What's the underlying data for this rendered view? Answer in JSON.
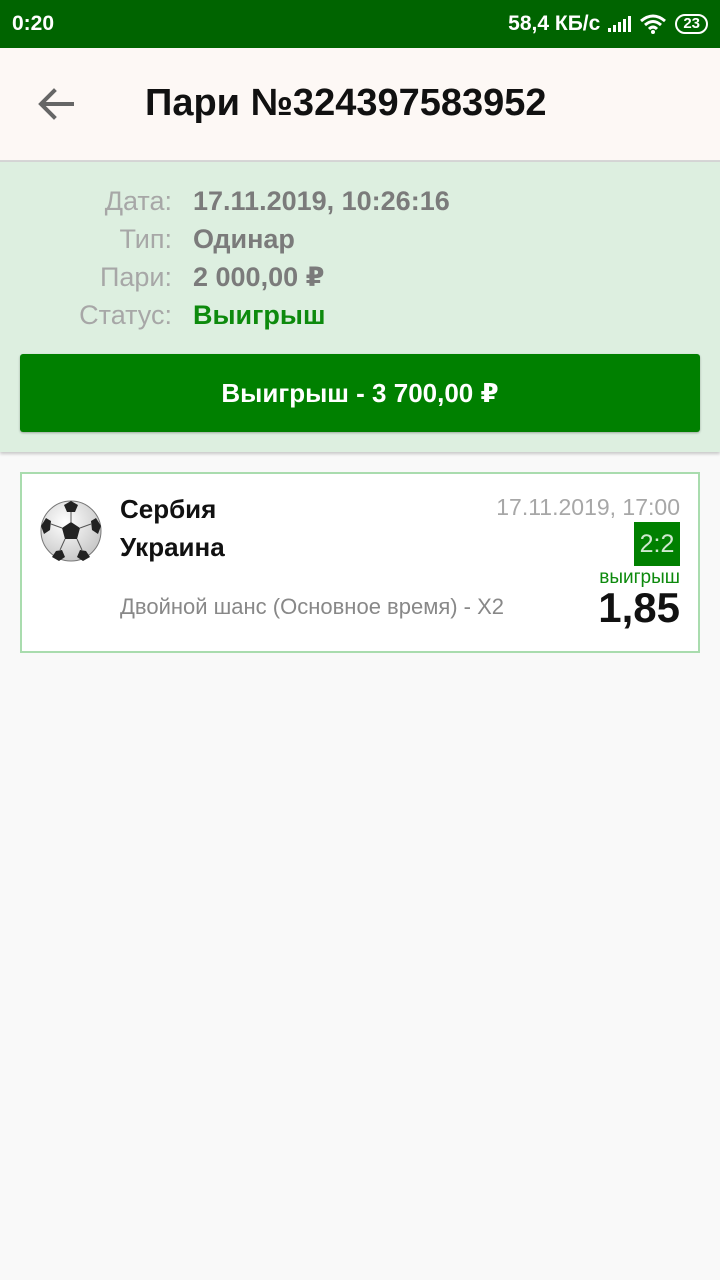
{
  "statusbar": {
    "time": "0:20",
    "speed": "58,4 КБ/с",
    "battery": "23",
    "icons": [
      "signal-icon",
      "wifi-icon",
      "battery-icon"
    ]
  },
  "appbar": {
    "title": "Пари №324397583952",
    "back_icon": "arrow-left-icon"
  },
  "details": {
    "date_label": "Дата:",
    "date_value": "17.11.2019, 10:26:16",
    "type_label": "Тип:",
    "type_value": "Одинар",
    "stake_label": "Пари:",
    "stake_value": "2 000,00 ₽",
    "status_label": "Статус:",
    "status_value": "Выигрыш",
    "status_color": "#0d8a0d"
  },
  "win_button": {
    "label": "Выигрыш - 3 700,00 ₽",
    "color": "#008000"
  },
  "event": {
    "sport_icon": "soccer-ball-icon",
    "team1": "Сербия",
    "team2": "Украина",
    "datetime": "17.11.2019, 17:00",
    "score": "2:2",
    "market": "Двойной шанс (Основное время) - X2",
    "result": "выигрыш",
    "odds": "1,85"
  }
}
